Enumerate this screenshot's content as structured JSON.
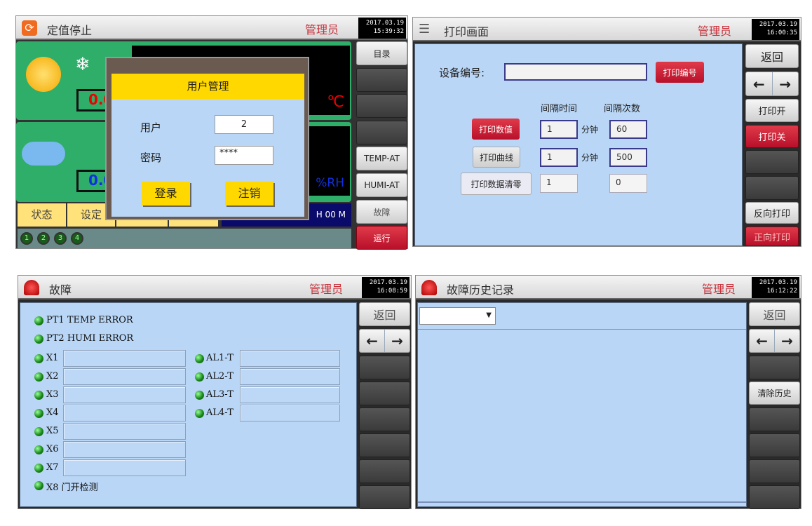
{
  "colors": {
    "accent_red": "#c8323c",
    "panel_green": "#2fae6a",
    "body_blue": "#b9d6f6",
    "dialog_yellow": "#ffd800"
  },
  "screen1": {
    "title": "定值停止",
    "role": "管理员",
    "date": "2017.03.19",
    "time": "15:39:32",
    "temp_pv": "0.0",
    "temp_unit": "℃",
    "humi_pv": "0.0",
    "humi_unit": "%RH",
    "timer": "H 00 M",
    "tabs": [
      "状态",
      "设定"
    ],
    "steps": [
      "1",
      "2",
      "3",
      "4"
    ],
    "buttons": [
      "目录",
      "",
      "",
      "",
      "TEMP-AT",
      "HUMI-AT",
      "故障",
      "运行"
    ],
    "dialog": {
      "title": "用户管理",
      "user_label": "用户",
      "user_value": "2",
      "pass_label": "密码",
      "pass_value": "****",
      "login": "登录",
      "logout": "注销"
    }
  },
  "screen2": {
    "title": "打印画面",
    "role": "管理员",
    "date": "2017.03.19",
    "time": "16:00:35",
    "device_label": "设备编号:",
    "device_value": "",
    "print_id": "打印编号",
    "col_interval": "间隔时间",
    "col_count": "间隔次数",
    "unit": "分钟",
    "rows": [
      {
        "label": "打印数值",
        "interval": "1",
        "count": "60"
      },
      {
        "label": "打印曲线",
        "interval": "1",
        "count": "500"
      },
      {
        "label": "打印数据清零",
        "interval": "1",
        "count": "0"
      }
    ],
    "buttons": {
      "back": "返回",
      "print_on": "打印开",
      "print_off": "打印关",
      "reverse": "反向打印",
      "forward": "正向打印"
    }
  },
  "screen3": {
    "title": "故障",
    "role": "管理员",
    "date": "2017.03.19",
    "time": "16:08:59",
    "errors": [
      "PT1 TEMP ERROR",
      "PT2 HUMI ERROR"
    ],
    "inputs": [
      "X1",
      "X2",
      "X3",
      "X4",
      "X5",
      "X6",
      "X7"
    ],
    "x8": "X8  门开检测",
    "alarms": [
      "AL1-T",
      "AL2-T",
      "AL3-T",
      "AL4-T"
    ],
    "back": "返回"
  },
  "screen4": {
    "title": "故障历史记录",
    "role": "管理员",
    "date": "2017.03.19",
    "time": "16:12:22",
    "dropdown_value": "",
    "back": "返回",
    "clear": "清除历史"
  }
}
